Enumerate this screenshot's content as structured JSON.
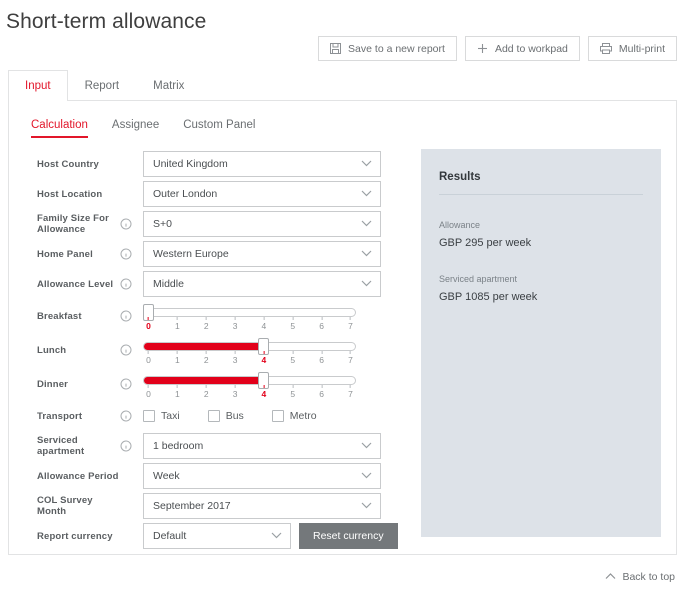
{
  "header": {
    "title": "Short-term allowance"
  },
  "toolbar": {
    "buttons": [
      {
        "label": "Save to a new report",
        "icon": "save-icon"
      },
      {
        "label": "Add to workpad",
        "icon": "plus-icon"
      },
      {
        "label": "Multi-print",
        "icon": "printer-icon"
      }
    ]
  },
  "tabs": [
    {
      "label": "Input",
      "active": true
    },
    {
      "label": "Report",
      "active": false
    },
    {
      "label": "Matrix",
      "active": false
    }
  ],
  "subtabs": [
    {
      "label": "Calculation",
      "active": true
    },
    {
      "label": "Assignee",
      "active": false
    },
    {
      "label": "Custom Panel",
      "active": false
    }
  ],
  "form": {
    "host_country": {
      "label": "Host Country",
      "value": "United Kingdom",
      "info": false
    },
    "host_location": {
      "label": "Host Location",
      "value": "Outer London",
      "info": false
    },
    "family_size": {
      "label": "Family Size For Allowance",
      "value": "S+0",
      "info": true
    },
    "home_panel": {
      "label": "Home Panel",
      "value": "Western Europe",
      "info": true
    },
    "allowance_level": {
      "label": "Allowance Level",
      "value": "Middle",
      "info": true
    },
    "breakfast": {
      "label": "Breakfast",
      "value": 0,
      "min": 0,
      "max": 7,
      "info": true
    },
    "lunch": {
      "label": "Lunch",
      "value": 4,
      "min": 0,
      "max": 7,
      "info": true
    },
    "dinner": {
      "label": "Dinner",
      "value": 4,
      "min": 0,
      "max": 7,
      "info": true
    },
    "transport": {
      "label": "Transport",
      "info": true,
      "options": [
        {
          "label": "Taxi",
          "checked": false
        },
        {
          "label": "Bus",
          "checked": false
        },
        {
          "label": "Metro",
          "checked": false
        }
      ]
    },
    "serviced_apartment": {
      "label": "Serviced apartment",
      "value": "1 bedroom",
      "info": true
    },
    "allowance_period": {
      "label": "Allowance Period",
      "value": "Week",
      "info": false
    },
    "col_survey_month": {
      "label": "COL Survey Month",
      "value": "September 2017",
      "info": false
    },
    "report_currency": {
      "label": "Report currency",
      "value": "Default",
      "info": false
    },
    "reset_currency_label": "Reset currency"
  },
  "slider_ticks": [
    "0",
    "1",
    "2",
    "3",
    "4",
    "5",
    "6",
    "7"
  ],
  "results": {
    "title": "Results",
    "items": [
      {
        "label": "Allowance",
        "value": "GBP 295 per week"
      },
      {
        "label": "Serviced apartment",
        "value": "GBP 1085 per week"
      }
    ]
  },
  "footer": {
    "back_to_top": "Back to top"
  },
  "colors": {
    "accent_red": "#e2162a",
    "slider_red": "#e2001a",
    "results_bg": "#dde2e8",
    "button_gray": "#74787b"
  }
}
